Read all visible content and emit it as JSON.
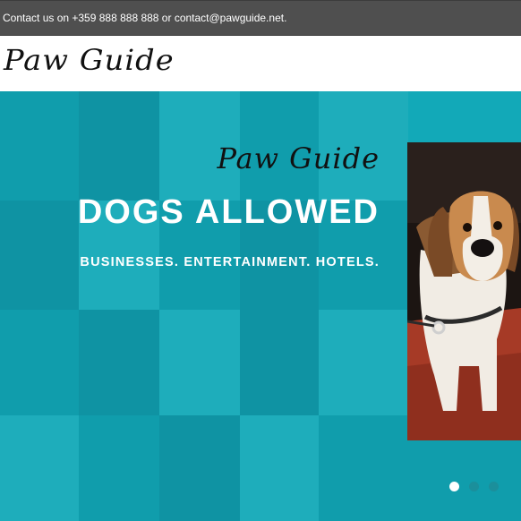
{
  "topbar": {
    "contact_text": "Contact us on +359 888 888 888 or contact@pawguide.net."
  },
  "header": {
    "logo_text": "Paw Guide"
  },
  "hero": {
    "logo_text": "Paw Guide",
    "title": "DOGS ALLOWED",
    "subtitle": "BUSINESSES. ENTERTAINMENT. HOTELS.",
    "image_icon": "beagle-dog-photo",
    "slides": [
      {
        "active": true
      },
      {
        "active": false
      },
      {
        "active": false
      }
    ]
  },
  "colors": {
    "topbar_bg": "#4f4f4f",
    "hero_bg": "#12a9b8",
    "active_dot": "#ffffff",
    "inactive_dot": "#1b8f9b"
  }
}
